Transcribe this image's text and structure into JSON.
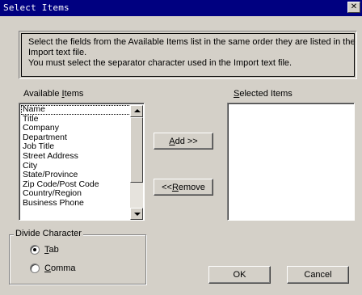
{
  "window": {
    "title": "Select Items",
    "close_glyph": "✕"
  },
  "info": {
    "line1": "Select the fields from the Available Items list in the same order they are listed in the",
    "line2": "Import text file.",
    "line3": "You must select the separator character used in the Import text file."
  },
  "available": {
    "label_pre": "Available ",
    "label_key": "I",
    "label_post": "tems",
    "items": [
      "Name",
      "Title",
      "Company",
      "Department",
      "Job Title",
      "Street Address",
      "City",
      "State/Province",
      "Zip Code/Post Code",
      "Country/Region",
      "Business Phone"
    ],
    "selected_index": 0
  },
  "selected": {
    "label_key": "S",
    "label_post": "elected Items",
    "items": []
  },
  "buttons": {
    "add_key": "A",
    "add_post": "dd >>",
    "remove_pre": "<< ",
    "remove_key": "R",
    "remove_post": "emove",
    "ok": "OK",
    "cancel": "Cancel"
  },
  "divide": {
    "legend": "Divide Character",
    "options": [
      {
        "key": "T",
        "rest": "ab",
        "checked": true
      },
      {
        "key": "C",
        "rest": "omma",
        "checked": false
      }
    ]
  },
  "icons": {
    "scroll_up": "triangle-up-icon",
    "scroll_down": "triangle-down-icon",
    "close": "close-icon"
  },
  "colors": {
    "titlebar": "#000080",
    "face": "#d4d0c8"
  }
}
